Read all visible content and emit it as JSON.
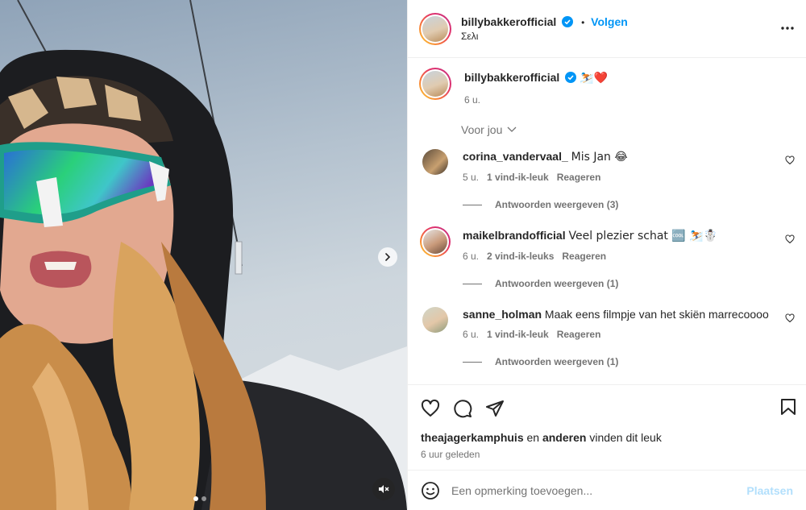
{
  "post": {
    "username": "billybakkerofficial",
    "follow_label": "Volgen",
    "bullet": "•",
    "location": "Σελι",
    "caption_emoji": "⛷️❤️",
    "caption_time": "6 u."
  },
  "feed_filter": "Voor jou",
  "comments": [
    {
      "username": "corina_vandervaal_",
      "text": "Mis Jan 😂",
      "time": "5 u.",
      "likes": "1 vind-ik-leuk",
      "reply_label": "Reageren",
      "replies": "Antwoorden weergeven (3)"
    },
    {
      "username": "maikelbrandofficial",
      "text": "Veel plezier schat 🆒 ⛷️☃️",
      "time": "6 u.",
      "likes": "2 vind-ik-leuks",
      "reply_label": "Reageren",
      "replies": "Antwoorden weergeven (1)"
    },
    {
      "username": "sanne_holman",
      "text": "Maak eens filmpje van het skiën marrecoooo",
      "time": "6 u.",
      "likes": "1 vind-ik-leuk",
      "reply_label": "Reageren",
      "replies": "Antwoorden weergeven (1)"
    }
  ],
  "likes": {
    "first_user": "theajagerkamphuis",
    "connector": "en",
    "others": "anderen",
    "suffix": "vinden dit leuk"
  },
  "posted_time": "6 uur geleden",
  "add_comment": {
    "placeholder": "Een opmerking toevoegen...",
    "post_label": "Plaatsen"
  },
  "colors": {
    "accent": "#0095f6",
    "muted": "#737373",
    "post_disabled": "#b2dffc"
  }
}
